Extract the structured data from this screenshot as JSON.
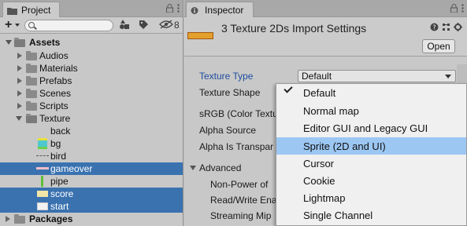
{
  "project_panel": {
    "tab_label": "Project",
    "search_placeholder": "",
    "hidden_count": "8",
    "tree": [
      {
        "label": "Assets",
        "type": "folder",
        "expanded": true,
        "bold": true
      },
      {
        "label": "Audios",
        "type": "folder"
      },
      {
        "label": "Materials",
        "type": "folder"
      },
      {
        "label": "Prefabs",
        "type": "folder"
      },
      {
        "label": "Scenes",
        "type": "folder"
      },
      {
        "label": "Scripts",
        "type": "folder"
      },
      {
        "label": "Texture",
        "type": "folder",
        "expanded": true
      },
      {
        "label": "back",
        "type": "texture"
      },
      {
        "label": "bg",
        "type": "texture"
      },
      {
        "label": "bird",
        "type": "texture"
      },
      {
        "label": "gameover",
        "type": "texture",
        "selected": true
      },
      {
        "label": "pipe",
        "type": "texture"
      },
      {
        "label": "score",
        "type": "texture",
        "selected": true
      },
      {
        "label": "start",
        "type": "texture",
        "selected": true
      },
      {
        "label": "Packages",
        "type": "folder",
        "bold": true
      }
    ]
  },
  "inspector": {
    "tab_label": "Inspector",
    "title": "3 Texture 2Ds Import Settings",
    "open_button": "Open",
    "properties": {
      "texture_type": "Texture Type",
      "texture_shape": "Texture Shape",
      "srgb": "sRGB (Color Textu",
      "alpha_source": "Alpha Source",
      "alpha_transparency": "Alpha Is Transpar",
      "advanced": "Advanced",
      "non_power": "Non-Power of",
      "read_write": "Read/Write Ena",
      "streaming_mip": "Streaming Mip"
    },
    "texture_type_value": "Default"
  },
  "menu": {
    "items": [
      {
        "label": "Default",
        "checked": true
      },
      {
        "label": "Normal map"
      },
      {
        "label": "Editor GUI and Legacy GUI"
      },
      {
        "label": "Sprite (2D and UI)",
        "hover": true
      },
      {
        "label": "Cursor"
      },
      {
        "label": "Cookie"
      },
      {
        "label": "Lightmap"
      },
      {
        "label": "Single Channel"
      }
    ]
  },
  "colors": {
    "selection": "#3a72b0",
    "menu_hover": "#9cc7f3",
    "link_blue": "#1e4ea0"
  },
  "icons": [
    "project-tab-icon",
    "inspector-tab-icon",
    "lock-icon",
    "menu-icon",
    "plus-icon",
    "search-icon",
    "filter-by-type-icon",
    "filter-by-label-icon",
    "hidden-visibility-icon",
    "help-icon",
    "preset-icon",
    "gear-icon",
    "check-icon"
  ]
}
